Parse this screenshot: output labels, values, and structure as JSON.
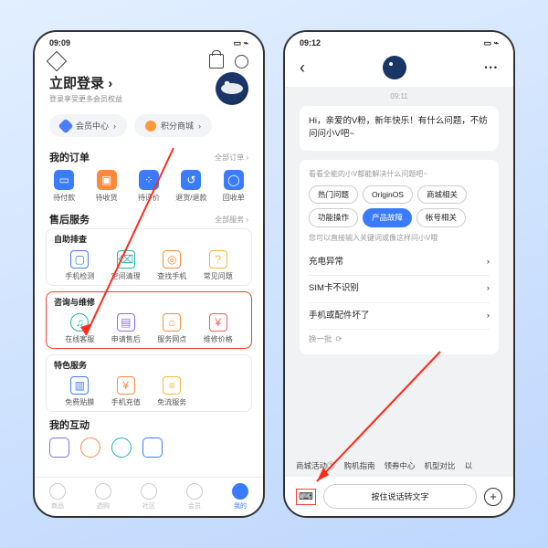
{
  "p1": {
    "status": {
      "time": "09:09",
      "icons": "✦ ⌖ ⌖ ⌖",
      "batt": "▭ ⌁"
    },
    "login": {
      "title": "立即登录",
      "chev": "›",
      "sub": "登录享受更多会员权益"
    },
    "pills": {
      "a": "会员中心",
      "achev": "›",
      "b": "积分商城",
      "bchev": "›"
    },
    "orders": {
      "title": "我的订单",
      "more": "全部订单 ›",
      "items": [
        "待付款",
        "待收货",
        "待评价",
        "退货/退款",
        "回收单"
      ]
    },
    "after": {
      "title": "售后服务",
      "more": "全部服务 ›",
      "box1": {
        "title": "自助排查",
        "items": [
          "手机检测",
          "空间清理",
          "查找手机",
          "常见问题"
        ]
      },
      "box2": {
        "title": "咨询与维修",
        "items": [
          "在线客服",
          "申请售后",
          "服务网点",
          "维修价格"
        ]
      },
      "box3": {
        "title": "特色服务",
        "items": [
          "免费贴膜",
          "手机充值",
          "免流服务"
        ]
      }
    },
    "inter": {
      "title": "我的互动"
    },
    "tabs": [
      "商品",
      "选购",
      "社区",
      "会员",
      "我的"
    ]
  },
  "p2": {
    "status": {
      "time": "09:12",
      "icons": "✦ ⌖ ⌖ ⌖",
      "batt": "▭ ⌁"
    },
    "ts": "09:11",
    "greet": "Hi，亲爱的V粉，新年快乐！有什么问题，不妨问问小V吧~",
    "sugTitle": "看看全能的小V都能解决什么问题吧~",
    "tags": [
      "热门问题",
      "OriginOS",
      "商城相关",
      "功能操作",
      "产品故障",
      "帐号相关"
    ],
    "tip": "您可以直接输入关键词或像这样问小V哦",
    "sugg": [
      "充电异常",
      "SIM卡不识别",
      "手机或配件坏了"
    ],
    "refresh": "换一批",
    "refIcon": "⟳",
    "chips": [
      "商城活动②",
      "购机指南",
      "领券中心",
      "机型对比",
      "以"
    ],
    "hold": "按住说话转文字",
    "plus": "+",
    "kb": "⌨"
  }
}
